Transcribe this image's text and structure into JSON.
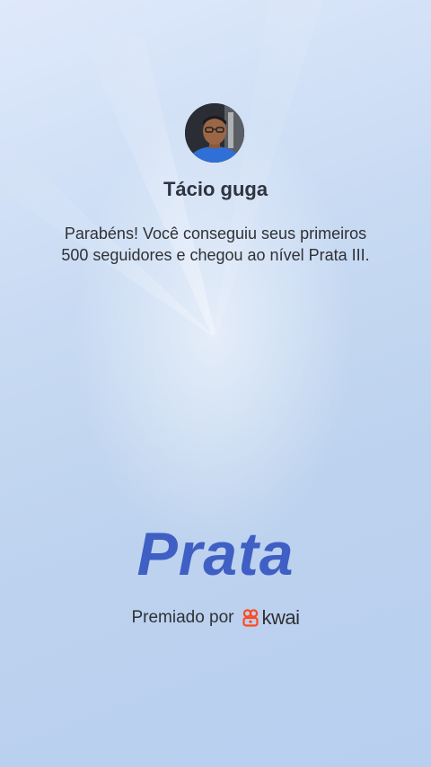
{
  "user": {
    "name": "Tácio guga"
  },
  "message": {
    "line1": "Parabéns! Você conseguiu seus primeiros",
    "line2": "500 seguidores e chegou ao nível Prata III."
  },
  "level": {
    "title": "Prata"
  },
  "award": {
    "label": "Premiado por",
    "brand": "kwai"
  },
  "colors": {
    "level_text": "#3f5fc4",
    "brand_icon": "#ff4a1f",
    "background": "#c9dbf3"
  },
  "icons": {
    "avatar": "user-photo",
    "brand": "kwai-logo-icon"
  }
}
